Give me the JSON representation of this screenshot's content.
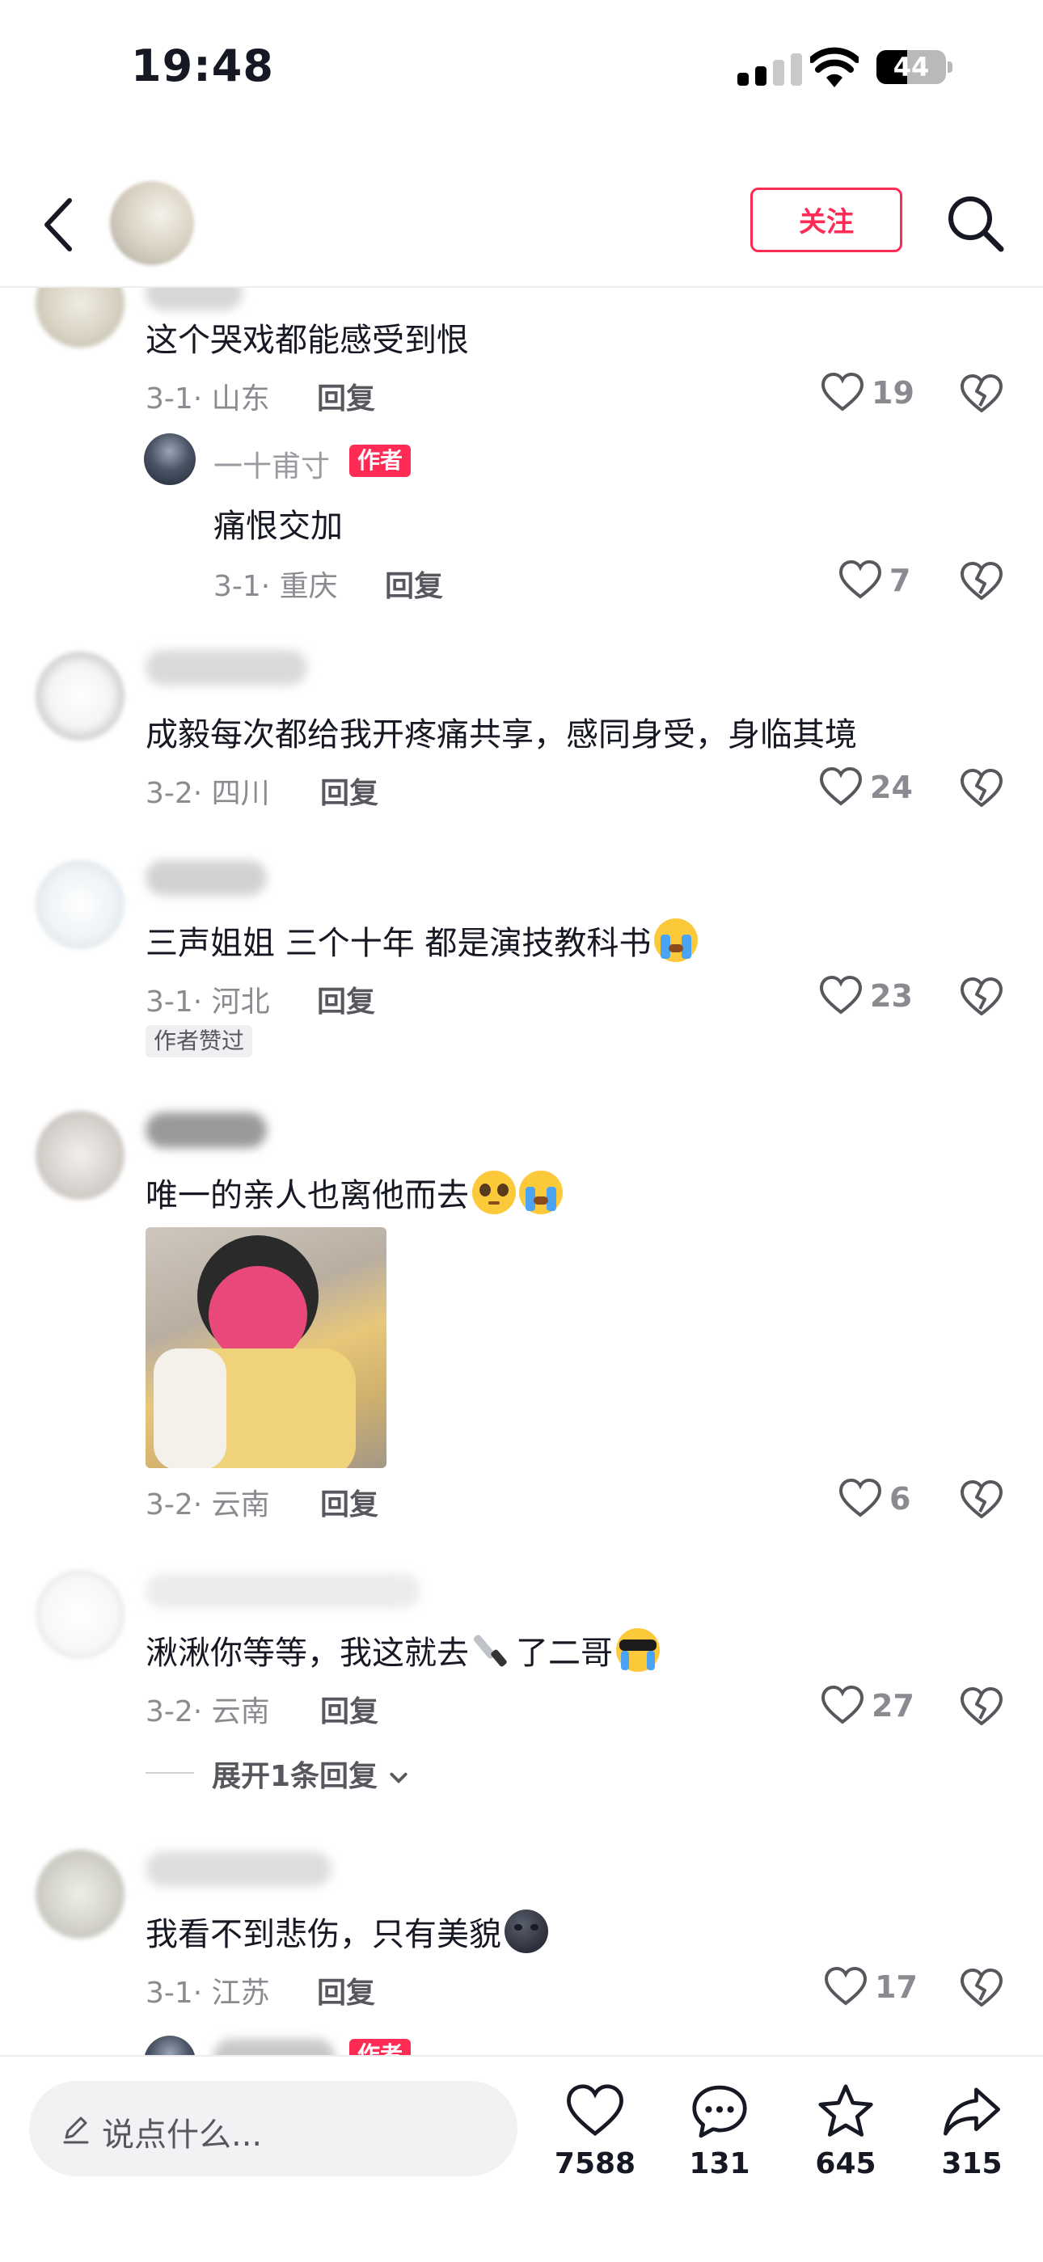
{
  "status": {
    "time": "19:48",
    "battery": "44"
  },
  "nav": {
    "follow_label": "关注"
  },
  "comments": [
    {
      "text": "这个哭戏都能感受到恨",
      "meta": "3-1· 山东",
      "reply": "回复",
      "likes": "19"
    },
    {
      "author": "一十甫寸",
      "author_tag": "作者",
      "text": "痛恨交加",
      "meta": "3-1· 重庆",
      "reply": "回复",
      "likes": "7"
    },
    {
      "text": "成毅每次都给我开疼痛共享，感同身受，身临其境",
      "meta": "3-2· 四川",
      "reply": "回复",
      "likes": "24"
    },
    {
      "text": "三声姐姐 三个十年 都是演技教科书",
      "meta": "3-1· 河北",
      "reply": "回复",
      "likes": "23",
      "badge": "作者赞过"
    },
    {
      "text": "唯一的亲人也离他而去",
      "meta": "3-2· 云南",
      "reply": "回复",
      "likes": "6"
    },
    {
      "text_a": "湫湫你等等，我这就去",
      "text_b": "了二哥",
      "meta": "3-2· 云南",
      "reply": "回复",
      "likes": "27",
      "expand": "展开1条回复"
    },
    {
      "text": "我看不到悲伤，只有美貌",
      "meta": "3-1· 江苏",
      "reply": "回复",
      "likes": "17"
    }
  ],
  "partial_reply": {
    "author_tag": "作者"
  },
  "bottom": {
    "placeholder": "说点什么...",
    "likes": "7588",
    "comments": "131",
    "favorites": "645",
    "shares": "315"
  },
  "colors": {
    "accent": "#fe2c55",
    "meta": "#8a8b91",
    "text": "#161823"
  },
  "icons": [
    "back-icon",
    "search-icon",
    "heart-icon",
    "broken-heart-icon",
    "pencil-icon",
    "comment-icon",
    "star-icon",
    "share-icon"
  ]
}
